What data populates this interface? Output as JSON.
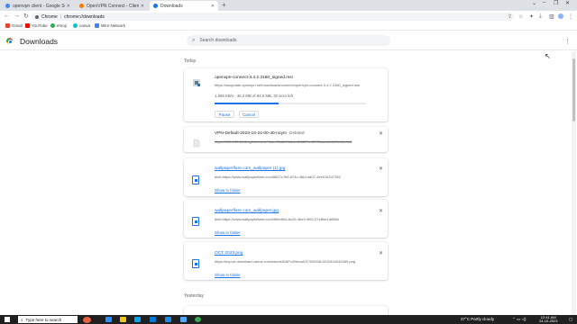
{
  "tabs": [
    {
      "label": "openvpn client - Google Search",
      "color": "#4285f4"
    },
    {
      "label": "OpenVPN Connect - Client Soft...",
      "color": "#f57c00"
    },
    {
      "label": "Downloads",
      "color": "#1a73e8"
    }
  ],
  "toolbar": {
    "back_icon": "back-arrow-icon",
    "site_label": "Chrome",
    "url": "chrome://downloads"
  },
  "bookmarks": [
    {
      "label": "Gmail",
      "color": "#ea4335"
    },
    {
      "label": "YouTube",
      "color": "#ff0000"
    },
    {
      "label": "emoji",
      "color": "#34a853"
    },
    {
      "label": "canva",
      "color": "#00c4cc"
    },
    {
      "label": "Wire Network",
      "color": "#4285f4"
    }
  ],
  "page": {
    "title": "Downloads",
    "search_placeholder": "Search downloads"
  },
  "sections": {
    "today": "Today",
    "yesterday": "Yesterday"
  },
  "downloads": [
    {
      "name": "openvpn-connect-3.4.2.3160_signed.msi",
      "url": "https://swupdate.openvpn.net/downloads/connect/openvpn-connect-3.4.2.3160_signed.msi",
      "progress_text": "1,555 KB/s - 35.2 MB of 84.5 MB, 32 secs left",
      "progress": 0.42,
      "pause_label": "Pause",
      "cancel_label": "Cancel"
    },
    {
      "name": "VPN-Default-2023-10-24-00-40-noym",
      "status": "Deleted",
      "url": "https://105.100.84.8/cgi-bin/ocsv?dsk=25d8d9b6cbd108f29e4209dacdd4440fc1ab4e6"
    },
    {
      "name": "wallpaperflare.com_wallpaper (1).jpg",
      "url": "blob:https://www.wallpaperflare.com/8607c7b9-874c-4f6d-ad07-4ee016247392",
      "show_label": "Show in folder"
    },
    {
      "name": "wallpaperflare.com_wallpaper.jpg",
      "url": "blob:https://www.wallpaperflare.com/46fe4f0d-6c29-4be9-9f62-07e8be1d658b",
      "show_label": "Show in folder"
    },
    {
      "name": "OCT 2023.png",
      "url": "https://export-download.canva.com/assets/DAFv2Neowi/37/0/0008-4010404043455.png",
      "show_label": "Show in folder"
    }
  ],
  "taskbar": {
    "search_placeholder": "Type here to search",
    "weather": "27°C  Partly cloudy",
    "time": "12:41 AM",
    "date": "24-10-2023",
    "apps": [
      "#e6633d",
      "#2d8cff",
      "#f0c419",
      "#00a4ef",
      "#0078d4",
      "#1e88e5",
      "#50a8ff",
      "#34a853"
    ]
  }
}
